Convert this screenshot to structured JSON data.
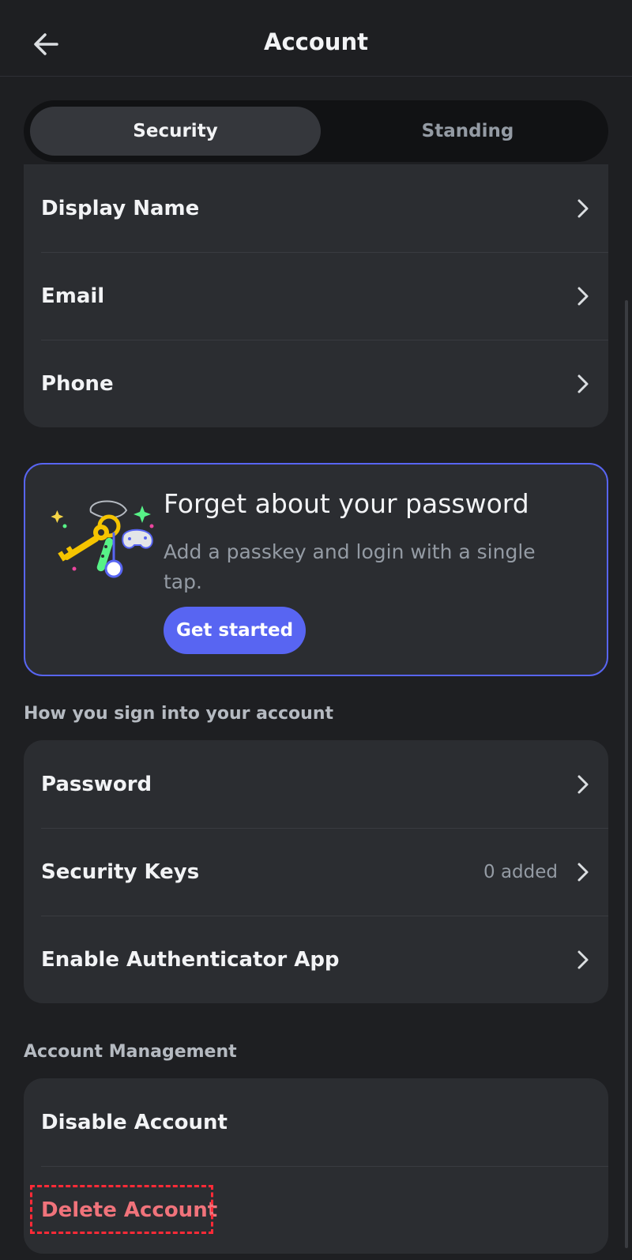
{
  "header": {
    "title": "Account"
  },
  "tabs": [
    {
      "label": "Security"
    },
    {
      "label": "Standing"
    }
  ],
  "profile_rows": [
    {
      "label": "Display Name"
    },
    {
      "label": "Email"
    },
    {
      "label": "Phone"
    }
  ],
  "passkey_banner": {
    "title": "Forget about your password",
    "description": "Add a passkey and login with a single tap.",
    "button_label": "Get started"
  },
  "sign_in_section": {
    "heading": "How you sign into your account",
    "rows": [
      {
        "label": "Password",
        "value": ""
      },
      {
        "label": "Security Keys",
        "value": "0 added"
      },
      {
        "label": "Enable Authenticator App",
        "value": ""
      }
    ]
  },
  "management_section": {
    "heading": "Account Management",
    "rows": [
      {
        "label": "Disable Account"
      },
      {
        "label": "Delete Account"
      }
    ]
  },
  "colors": {
    "background": "#1e1f22",
    "card": "#2b2d31",
    "accent": "#5865f2",
    "danger_text": "#f0737b",
    "highlight_box": "#ff2a37"
  }
}
